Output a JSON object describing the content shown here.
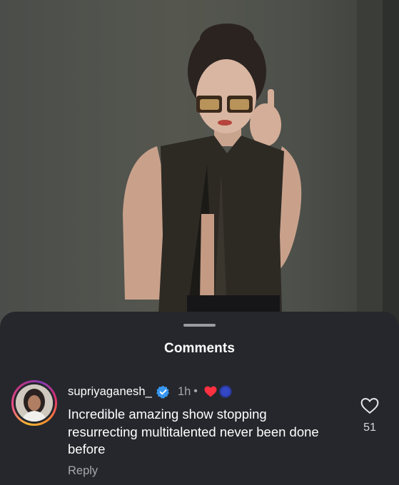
{
  "sheet": {
    "title": "Comments"
  },
  "comment": {
    "username": "supriyaganesh_",
    "time": "1h",
    "separator": "•",
    "text": "Incredible amazing show stopping resurrecting multitalented never been done before",
    "reply_label": "Reply",
    "like_count": "51",
    "verified": true,
    "liker_icons": [
      "red-heart-icon",
      "blue-circle-icon"
    ]
  },
  "colors": {
    "sheet_background": "#25272c",
    "verified_blue": "#3897f0",
    "secondary_text": "#a5a7ad"
  }
}
